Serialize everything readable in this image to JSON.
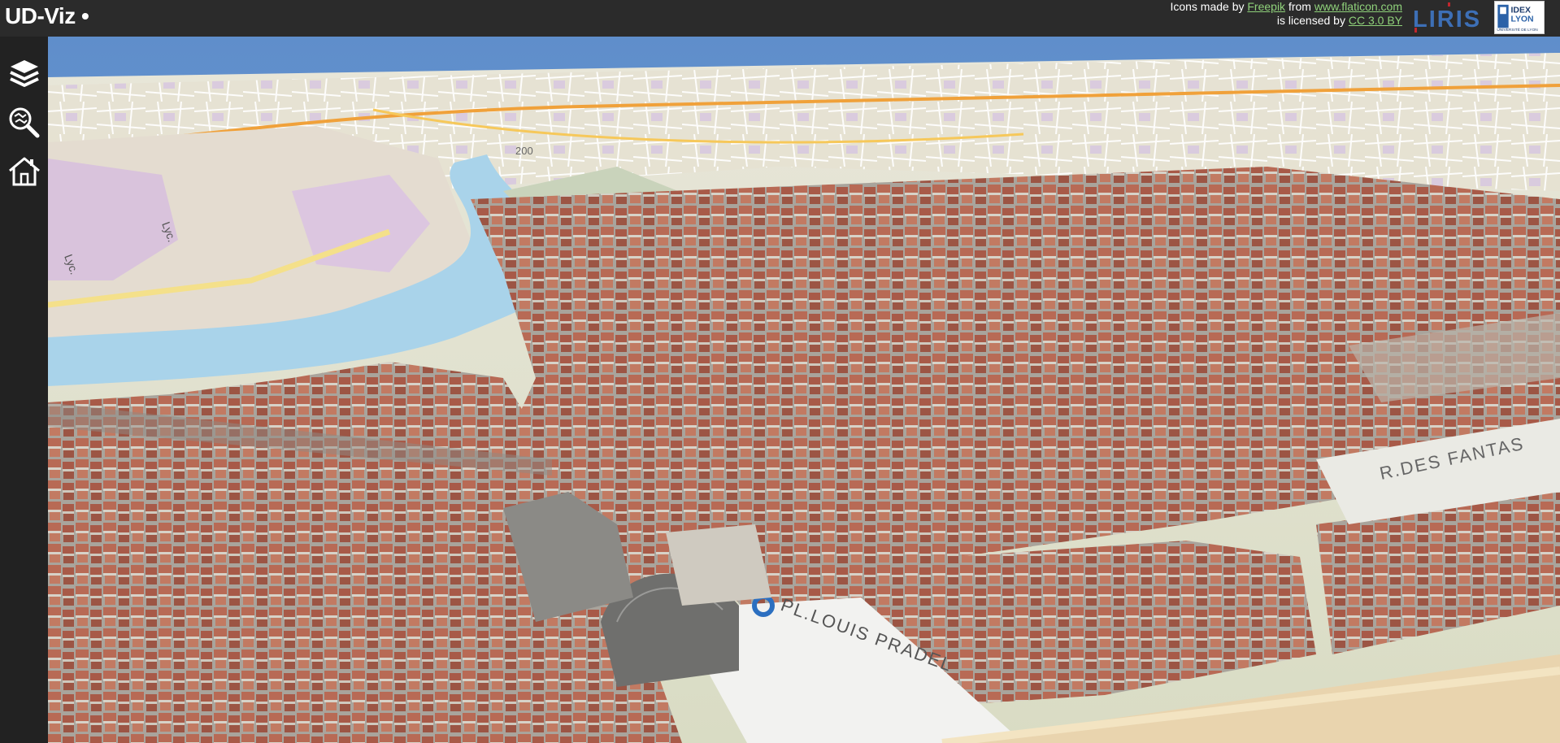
{
  "app": {
    "title": "UD-Viz •"
  },
  "credits": {
    "line1_prefix": "Icons made by ",
    "freepik": "Freepik",
    "line1_mid": " from ",
    "flaticon": "www.flaticon.com",
    "line2_prefix": "is licensed by ",
    "license": "CC 3.0 BY"
  },
  "logos": {
    "liris": "LIRIS",
    "idex_line1": "IDEX",
    "idex_line2": "LYON",
    "idex_line3": "UNIVERSITÉ DE LYON"
  },
  "sidebar": {
    "buttons": [
      {
        "icon": "layers-icon",
        "purpose": "layers"
      },
      {
        "icon": "search-map-icon",
        "purpose": "search"
      },
      {
        "icon": "home-icon",
        "purpose": "home"
      }
    ]
  },
  "map": {
    "labels": {
      "rue_des_fantasques": "R.DES FANTAS",
      "louis_pradel": "PL.LOUIS PRADEL",
      "contour_200": "200",
      "lyc": "Lyc.",
      "lyc2": "Lyc."
    }
  },
  "colors": {
    "header_bg": "#2b2b2b",
    "sidebar_bg": "#222222",
    "link": "#8fd17a",
    "river": "#a9d3ea",
    "sky": "#6f98c8",
    "roof": "#b56a55"
  }
}
